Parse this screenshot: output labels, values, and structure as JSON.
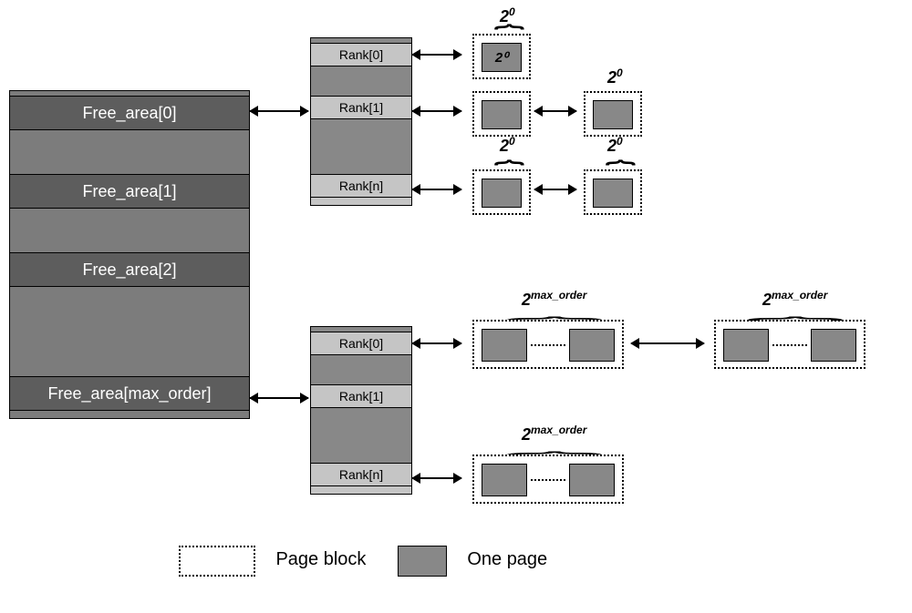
{
  "free_area_labels": {
    "row0": "Free_area[0]",
    "row1": "Free_area[1]",
    "row2": "Free_area[2]",
    "row_last": "Free_area[max_order]"
  },
  "rank_labels": {
    "r0": "Rank[0]",
    "r1": "Rank[1]",
    "rn": "Rank[n]"
  },
  "power_labels": {
    "zero_base": "2",
    "zero_exp": "0",
    "max_base": "2",
    "max_exp": "max_order"
  },
  "first_block_text": "2⁰",
  "legend": {
    "page_block": "Page block",
    "one_page": "One page"
  }
}
